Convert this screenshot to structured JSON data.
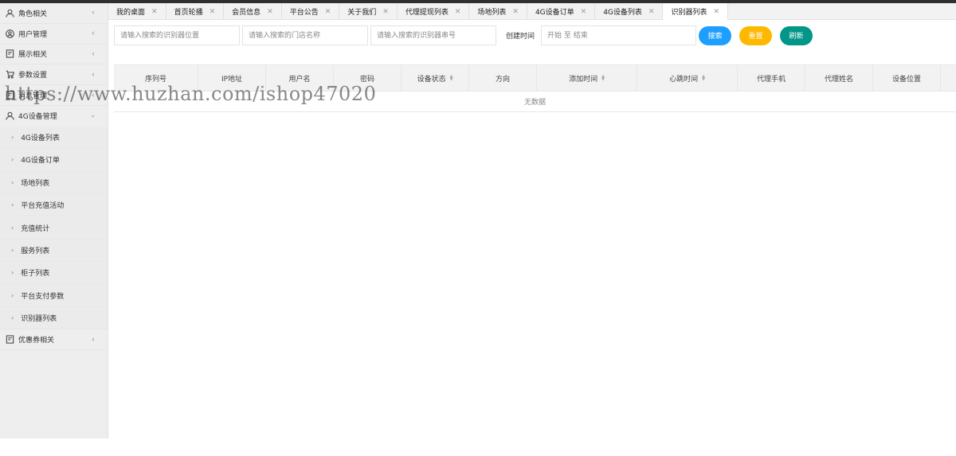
{
  "sidebar": {
    "top_items": [
      {
        "label": "角色相关",
        "icon": "user-icon"
      },
      {
        "label": "用户管理",
        "icon": "user-circle-icon"
      },
      {
        "label": "展示相关",
        "icon": "document-icon"
      },
      {
        "label": "参数设置",
        "icon": "cart-icon"
      },
      {
        "label": "消息管理",
        "icon": "document-icon"
      },
      {
        "label": "4G设备管理",
        "icon": "user-icon"
      }
    ],
    "sub_items": [
      {
        "label": "4G设备列表"
      },
      {
        "label": "4G设备订单"
      },
      {
        "label": "场地列表"
      },
      {
        "label": "平台充值活动"
      },
      {
        "label": "充值统计"
      },
      {
        "label": "服务列表"
      },
      {
        "label": "柜子列表"
      },
      {
        "label": "平台支付参数"
      },
      {
        "label": "识别器列表"
      }
    ],
    "bottom_item": {
      "label": "优惠券相关",
      "icon": "document-icon"
    }
  },
  "tabs": [
    {
      "label": "我的桌面"
    },
    {
      "label": "首页轮播"
    },
    {
      "label": "会员信息"
    },
    {
      "label": "平台公告"
    },
    {
      "label": "关于我们"
    },
    {
      "label": "代理提现列表"
    },
    {
      "label": "场地列表"
    },
    {
      "label": "4G设备订单"
    },
    {
      "label": "4G设备列表"
    },
    {
      "label": "识别器列表",
      "active": true
    }
  ],
  "filters": {
    "location_placeholder": "请输入搜索的识别器位置",
    "store_placeholder": "请输入搜索的门店名称",
    "serial_placeholder": "请输入搜索的识别器串号",
    "created_label": "创建时间",
    "date_range_placeholder": "开始 至 结束",
    "search_label": "搜索",
    "reset_label": "重置",
    "refresh_label": "刷新"
  },
  "colors": {
    "search": "#1e9fff",
    "reset": "#ffb800",
    "refresh": "#009688"
  },
  "table": {
    "columns": [
      {
        "label": "序列号",
        "sortable": false
      },
      {
        "label": "IP地址",
        "sortable": false
      },
      {
        "label": "用户名",
        "sortable": false
      },
      {
        "label": "密码",
        "sortable": false
      },
      {
        "label": "设备状态",
        "sortable": true
      },
      {
        "label": "方向",
        "sortable": false
      },
      {
        "label": "添加时间",
        "sortable": true
      },
      {
        "label": "心跳时间",
        "sortable": true
      },
      {
        "label": "代理手机",
        "sortable": false
      },
      {
        "label": "代理姓名",
        "sortable": false
      },
      {
        "label": "设备位置",
        "sortable": false
      }
    ],
    "empty_text": "无数据"
  },
  "watermark": "https://www.huzhan.com/ishop47020"
}
